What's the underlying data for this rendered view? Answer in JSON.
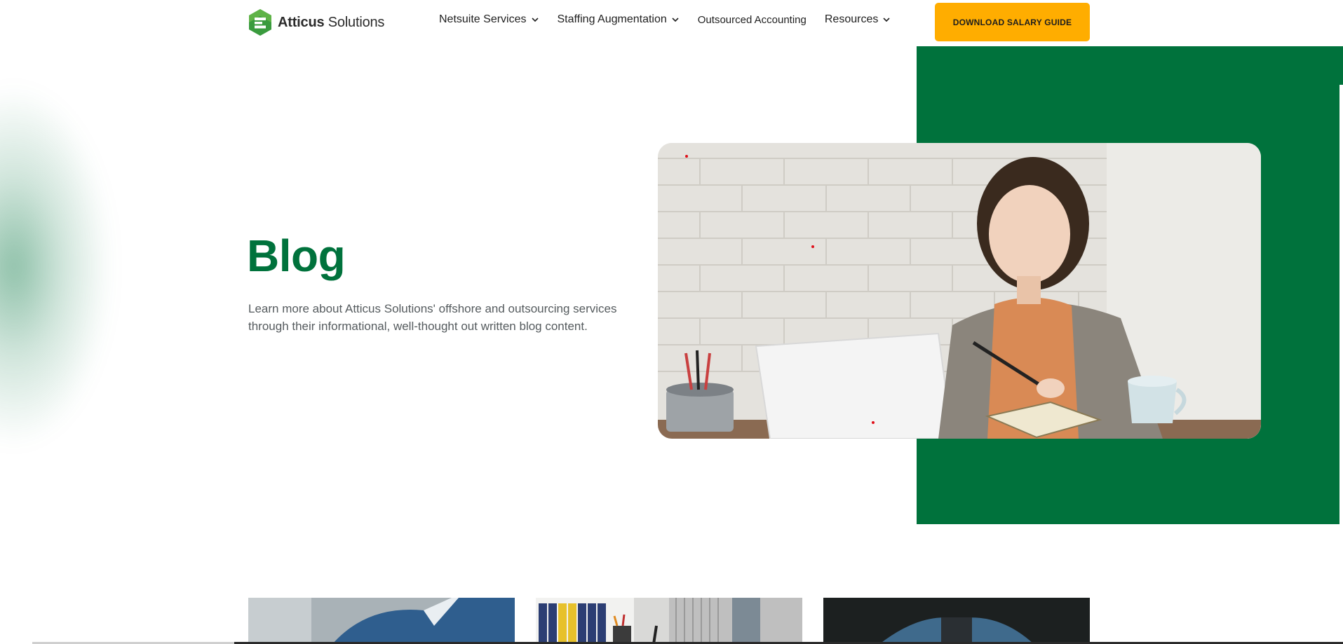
{
  "brand": {
    "name_bold": "Atticus",
    "name_light": "Solutions",
    "primary_color": "#00723C",
    "accent_color": "#FFAD00",
    "logo_icon": "atticus-hexagon-logo"
  },
  "nav": {
    "items": [
      {
        "label": "Netsuite Services",
        "has_dropdown": true,
        "icon": "chevron-down-icon"
      },
      {
        "label": "Staffing Augmentation",
        "has_dropdown": true,
        "icon": "chevron-down-icon"
      },
      {
        "label": "Outsourced Accounting",
        "has_dropdown": false
      },
      {
        "label": "Resources",
        "has_dropdown": true,
        "icon": "chevron-down-icon"
      }
    ],
    "cta_label": "DOWNLOAD SALARY GUIDE"
  },
  "hero": {
    "title": "Blog",
    "description": "Learn more about Atticus Solutions' offshore and outsourcing services through their informational, well-thought out written blog content.",
    "image_icon": "woman-writing-at-laptop-photo"
  },
  "cards": [
    {
      "image_icon": "person-in-blue-jacket-photo"
    },
    {
      "image_icon": "office-desk-with-binders-photo"
    },
    {
      "image_icon": "man-in-blue-blazer-photo"
    }
  ]
}
